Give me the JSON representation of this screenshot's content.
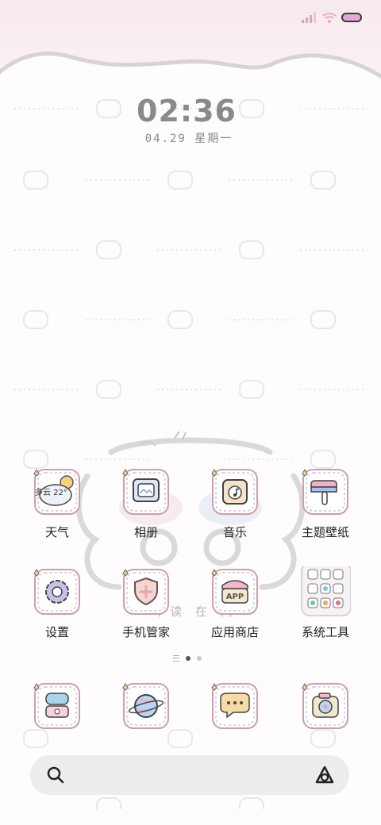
{
  "status_bar": {
    "signal": "signal-bars-icon",
    "wifi": "wifi-icon",
    "battery": "battery-icon"
  },
  "clock": {
    "time": "02:36",
    "date": "04.29  星期一"
  },
  "wallpaper": {
    "tagline": "一不读 在 间一"
  },
  "apps_row1": [
    {
      "name": "weather",
      "label": "天气",
      "badge": "多云 22°",
      "icon": "cloud-sun-icon"
    },
    {
      "name": "gallery",
      "label": "相册",
      "icon": "photo-frame-icon"
    },
    {
      "name": "music",
      "label": "音乐",
      "icon": "record-player-icon"
    },
    {
      "name": "themes",
      "label": "主题壁纸",
      "icon": "paint-brush-icon"
    }
  ],
  "apps_row2": [
    {
      "name": "settings",
      "label": "设置",
      "icon": "gear-icon"
    },
    {
      "name": "phone-manager",
      "label": "手机管家",
      "icon": "shield-icon"
    },
    {
      "name": "app-store",
      "label": "应用商店",
      "icon": "app-store-icon"
    },
    {
      "name": "system-tools",
      "label": "系统工具",
      "icon": "folder-grid-icon"
    }
  ],
  "dock": [
    {
      "name": "phone",
      "icon": "telephone-icon"
    },
    {
      "name": "browser",
      "icon": "globe-icon"
    },
    {
      "name": "messages",
      "icon": "chat-bubble-icon"
    },
    {
      "name": "camera",
      "icon": "camera-icon"
    }
  ],
  "search": {
    "search_icon": "search-icon",
    "assistant_icon": "assistant-icon"
  },
  "colors": {
    "accent_pink": "#f3a7c8",
    "frame_pink": "#d9a3b4",
    "text": "#222222"
  }
}
